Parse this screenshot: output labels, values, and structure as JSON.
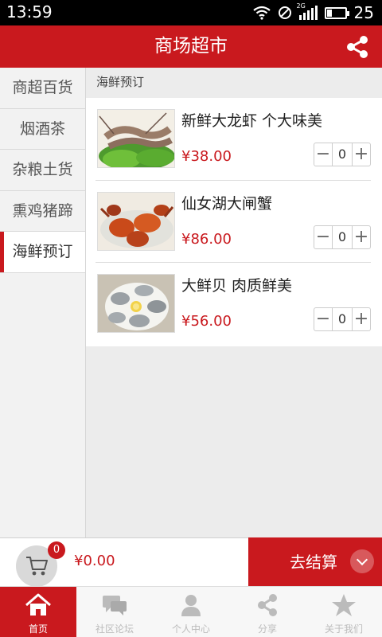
{
  "status_bar": {
    "time": "13:59",
    "network": "2G",
    "battery": "25"
  },
  "header": {
    "title": "商场超市"
  },
  "sidebar": {
    "categories": [
      {
        "label": "商超百货"
      },
      {
        "label": "烟酒茶"
      },
      {
        "label": "杂粮土货"
      },
      {
        "label": "熏鸡猪蹄"
      },
      {
        "label": "海鲜预订",
        "active": true
      }
    ]
  },
  "main": {
    "section_title": "海鲜预订",
    "products": [
      {
        "name": "新鲜大龙虾 个大味美",
        "price": "¥38.00",
        "qty": "0",
        "minus": "−",
        "plus": "+"
      },
      {
        "name": "仙女湖大闸蟹",
        "price": "¥86.00",
        "qty": "0",
        "minus": "−",
        "plus": "+"
      },
      {
        "name": "大鲜贝 肉质鲜美",
        "price": "¥56.00",
        "qty": "0",
        "minus": "−",
        "plus": "+"
      }
    ]
  },
  "cart": {
    "count": "0",
    "total": "¥0.00",
    "checkout_label": "去结算"
  },
  "tabs": [
    {
      "label": "首页",
      "icon": "home-icon",
      "active": true
    },
    {
      "label": "社区论坛",
      "icon": "chat-icon"
    },
    {
      "label": "个人中心",
      "icon": "person-icon"
    },
    {
      "label": "分享",
      "icon": "share-icon"
    },
    {
      "label": "关于我们",
      "icon": "star-icon"
    }
  ],
  "colors": {
    "brand": "#c9191e",
    "price": "#c9191e"
  }
}
